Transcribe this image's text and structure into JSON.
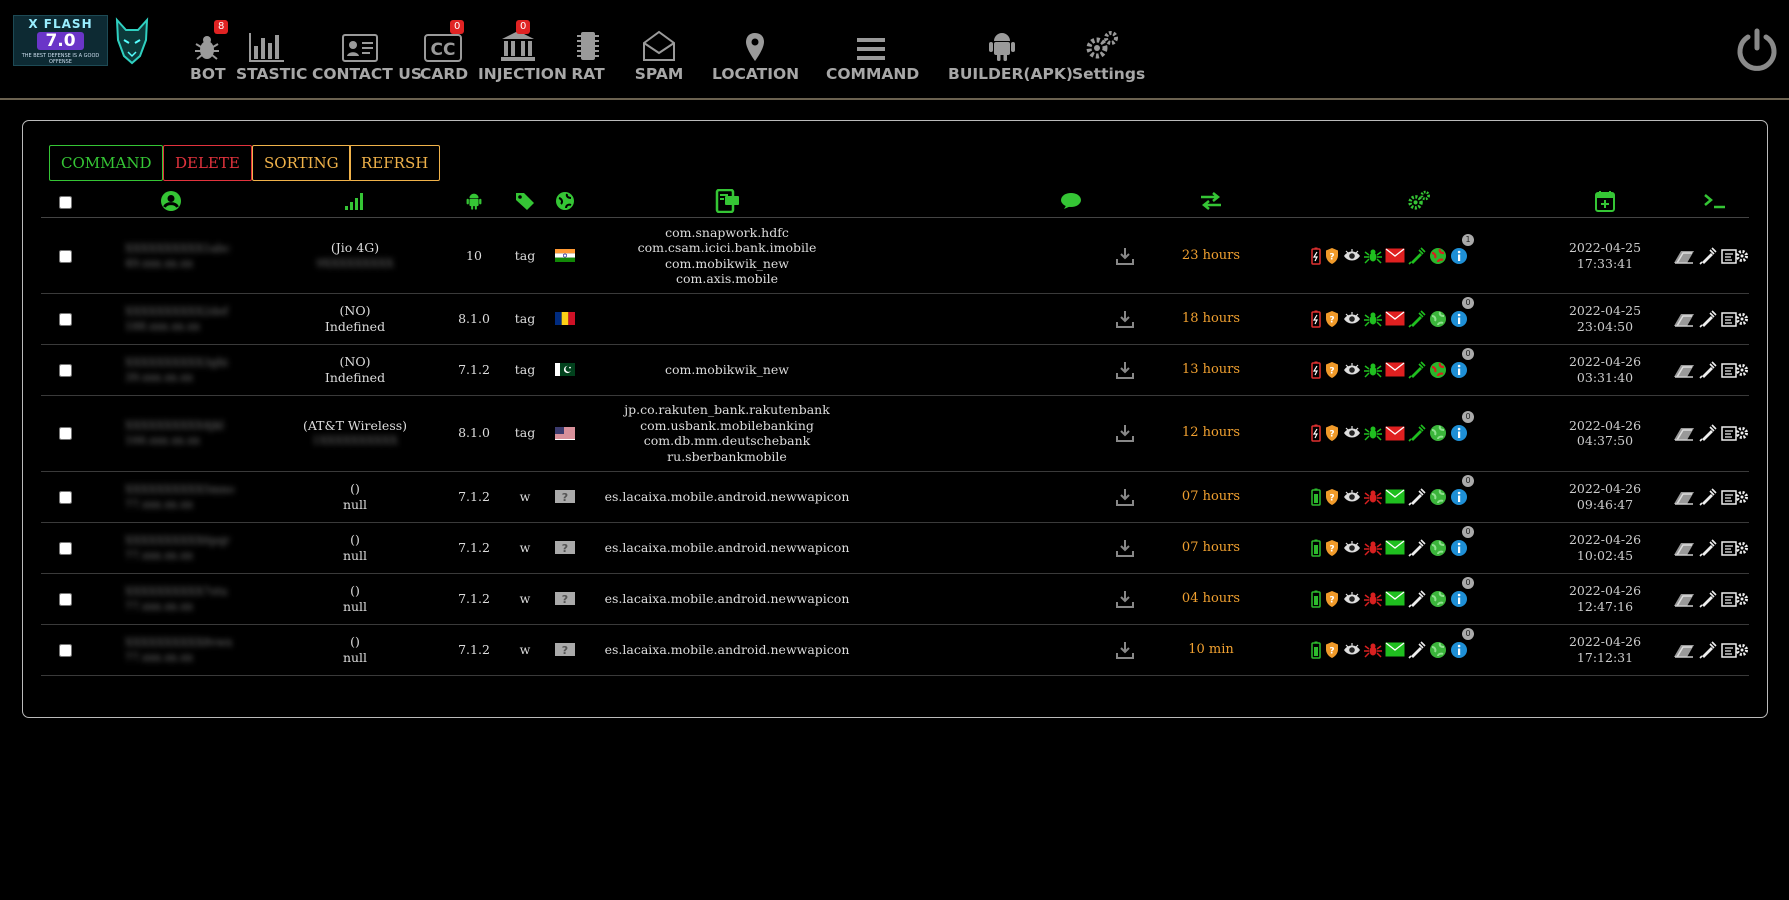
{
  "brand": {
    "logo_title": "X FLASH",
    "logo_version": "7.0",
    "logo_tagline": "THE BEST DEFENSE IS A GOOD OFFENSE"
  },
  "nav": {
    "bot": {
      "label": "BOT",
      "badge": "8"
    },
    "stastic": {
      "label": "STASTIC"
    },
    "contact": {
      "label": "CONTACT US"
    },
    "card": {
      "label": "CARD",
      "badge": "0"
    },
    "injection": {
      "label": "INJECTION",
      "badge": "0"
    },
    "rat": {
      "label": "RAT"
    },
    "spam": {
      "label": "SPAM"
    },
    "location": {
      "label": "LOCATION"
    },
    "command": {
      "label": "COMMAND"
    },
    "builder": {
      "label": "BUILDER(APK)"
    },
    "settings": {
      "label": "Settings"
    }
  },
  "toolbar": {
    "command": "COMMAND",
    "delete": "DELETE",
    "sorting": "SORTING",
    "refresh": "REFRSH"
  },
  "colors": {
    "accent_green": "#35c535",
    "delete_red": "#e2333d",
    "sort_orange": "#f0b24a",
    "time_orange": "#f0a030"
  },
  "rows": [
    {
      "id": "XXXXXXXXXX1abc",
      "ip": "49.xxx.xx.xx",
      "op": "(Jio 4G)",
      "op2": "9XXXXXXXXX",
      "ver": "10",
      "tag": "tag",
      "flag": "india-flag",
      "apps": [
        "com.snapwork.hdfc",
        "com.csam.icici.bank.imobile",
        "com.mobikwik_new",
        "com.axis.mobile"
      ],
      "time": "23 hours",
      "count": "1",
      "date": "2022-04-25",
      "clock": "17:33:41"
    },
    {
      "id": "XXXXXXXXXX2def",
      "ip": "188.xxx.xx.xx",
      "op": "(NO)",
      "op2": "Indefined",
      "ver": "8.1.0",
      "tag": "tag",
      "flag": "romania-flag",
      "apps": [],
      "time": "18 hours",
      "count": "0",
      "date": "2022-04-25",
      "clock": "23:04:50"
    },
    {
      "id": "XXXXXXXXXX3ghi",
      "ip": "39.xxx.xx.xx",
      "op": "(NO)",
      "op2": "Indefined",
      "ver": "7.1.2",
      "tag": "tag",
      "flag": "pakistan-flag",
      "apps": [
        "com.mobikwik_new"
      ],
      "time": "13 hours",
      "count": "0",
      "date": "2022-04-26",
      "clock": "03:31:40"
    },
    {
      "id": "XXXXXXXXXX4jkl",
      "ip": "166.xxx.xx.xx",
      "op": "(AT&T Wireless)",
      "op2": "1XXXXXXXXXX",
      "ver": "8.1.0",
      "tag": "tag",
      "flag": "usa-flag",
      "apps": [
        "jp.co.rakuten_bank.rakutenbank",
        "com.usbank.mobilebanking",
        "com.db.mm.deutschebank",
        "ru.sberbankmobile"
      ],
      "time": "12 hours",
      "count": "0",
      "date": "2022-04-26",
      "clock": "04:37:50"
    },
    {
      "id": "XXXXXXXXXX5mno",
      "ip": "77.xxx.xx.xx",
      "op": "()",
      "op2": "null",
      "ver": "7.1.2",
      "tag": "w",
      "flag": "unknown-flag",
      "apps": [
        "es.lacaixa.mobile.android.newwapicon"
      ],
      "time": "07 hours",
      "count": "0",
      "date": "2022-04-26",
      "clock": "09:46:47"
    },
    {
      "id": "XXXXXXXXXX6pqr",
      "ip": "77.xxx.xx.xx",
      "op": "()",
      "op2": "null",
      "ver": "7.1.2",
      "tag": "w",
      "flag": "unknown-flag",
      "apps": [
        "es.lacaixa.mobile.android.newwapicon"
      ],
      "time": "07 hours",
      "count": "0",
      "date": "2022-04-26",
      "clock": "10:02:45"
    },
    {
      "id": "XXXXXXXXXX7stu",
      "ip": "77.xxx.xx.xx",
      "op": "()",
      "op2": "null",
      "ver": "7.1.2",
      "tag": "w",
      "flag": "unknown-flag",
      "apps": [
        "es.lacaixa.mobile.android.newwapicon"
      ],
      "time": "04 hours",
      "count": "0",
      "date": "2022-04-26",
      "clock": "12:47:16"
    },
    {
      "id": "XXXXXXXXXX8vwx",
      "ip": "77.xxx.xx.xx",
      "op": "()",
      "op2": "null",
      "ver": "7.1.2",
      "tag": "w",
      "flag": "unknown-flag",
      "apps": [
        "es.lacaixa.mobile.android.newwapicon"
      ],
      "time": "10 min",
      "count": "0",
      "date": "2022-04-26",
      "clock": "17:12:31"
    }
  ]
}
